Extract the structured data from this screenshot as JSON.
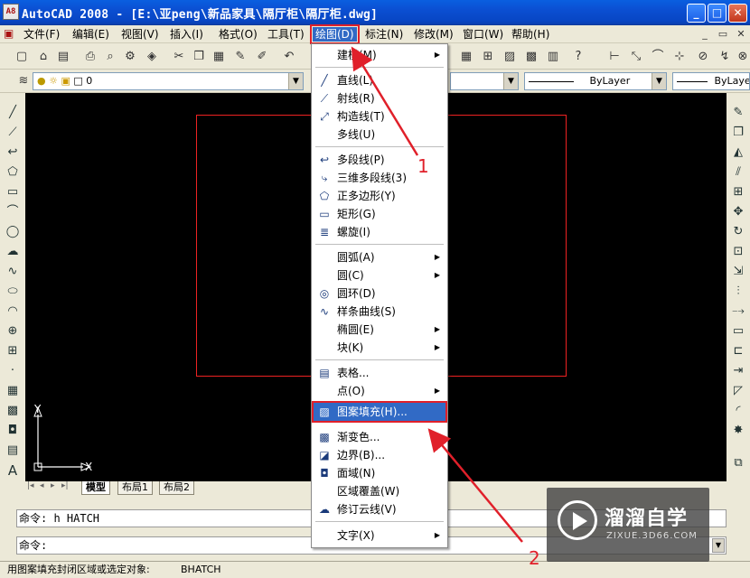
{
  "title_bar": {
    "logo": "A8",
    "title": "AutoCAD 2008 - [E:\\亚peng\\新品家具\\隔厅柜\\隔厅柜.dwg]",
    "buttons": {
      "minimize": "_",
      "maximize": "□",
      "close": "✕"
    }
  },
  "menubar": {
    "items": [
      {
        "label": "文件(F)"
      },
      {
        "label": "编辑(E)"
      },
      {
        "label": "视图(V)"
      },
      {
        "label": "插入(I)"
      },
      {
        "label": "格式(O)"
      },
      {
        "label": "工具(T)"
      },
      {
        "label": "绘图(D)"
      },
      {
        "label": "标注(N)"
      },
      {
        "label": "修改(M)"
      },
      {
        "label": "窗口(W)"
      },
      {
        "label": "帮助(H)"
      }
    ],
    "mdi": {
      "minimize": "_",
      "restore": "▭",
      "close": "✕"
    }
  },
  "layer_toolbar": {
    "layer_value": "0",
    "color_value": "ByLayer",
    "linetype_value": "ByLayer"
  },
  "draw_menu": {
    "items": [
      {
        "label": "建模(M)",
        "icon": "none",
        "submenu": true
      },
      {
        "label": "直线(L)",
        "icon": "line-icon"
      },
      {
        "label": "射线(R)",
        "icon": "ray-icon"
      },
      {
        "label": "构造线(T)",
        "icon": "xline-icon"
      },
      {
        "label": "多线(U)",
        "icon": "none"
      },
      {
        "label": "多段线(P)",
        "icon": "polyline-icon"
      },
      {
        "label": "三维多段线(3)",
        "icon": "3dpoly-icon"
      },
      {
        "label": "正多边形(Y)",
        "icon": "polygon-icon"
      },
      {
        "label": "矩形(G)",
        "icon": "rectangle-icon"
      },
      {
        "label": "螺旋(I)",
        "icon": "helix-icon"
      },
      {
        "label": "圆弧(A)",
        "icon": "none",
        "submenu": true
      },
      {
        "label": "圆(C)",
        "icon": "none",
        "submenu": true
      },
      {
        "label": "圆环(D)",
        "icon": "donut-icon"
      },
      {
        "label": "样条曲线(S)",
        "icon": "spline-icon"
      },
      {
        "label": "椭圆(E)",
        "icon": "none",
        "submenu": true
      },
      {
        "label": "块(K)",
        "icon": "none",
        "submenu": true
      },
      {
        "label": "表格...",
        "icon": "table-icon"
      },
      {
        "label": "点(O)",
        "icon": "none",
        "submenu": true
      },
      {
        "label": "图案填充(H)...",
        "icon": "hatch-icon",
        "highlighted": true
      },
      {
        "label": "渐变色...",
        "icon": "gradient-icon"
      },
      {
        "label": "边界(B)...",
        "icon": "boundary-icon"
      },
      {
        "label": "面域(N)",
        "icon": "region-icon"
      },
      {
        "label": "区域覆盖(W)",
        "icon": "none"
      },
      {
        "label": "修订云线(V)",
        "icon": "revcloud-icon"
      },
      {
        "label": "文字(X)",
        "icon": "none",
        "submenu": true
      }
    ]
  },
  "layout_tabs": [
    {
      "label": "模型"
    },
    {
      "label": "布局1"
    },
    {
      "label": "布局2"
    }
  ],
  "command": {
    "history": "命令: h HATCH",
    "prompt": "命令:"
  },
  "status_bar": {
    "hint": "用图案填充封闭区域或选定对象:",
    "command_name": "BHATCH"
  },
  "annotations": {
    "label_1": "1",
    "label_2": "2"
  },
  "ucs": {
    "y_label": "Y",
    "x_label": "X"
  },
  "watermark": {
    "title": "溜溜自学",
    "url": "ZIXUE.3D66.COM"
  },
  "colors": {
    "title_bar": "#0a5fe0",
    "menu_highlight": "#316ac5",
    "annotation_red": "#e0202a",
    "drawing_background": "#000000",
    "frame_rectangle": "#e22222"
  }
}
